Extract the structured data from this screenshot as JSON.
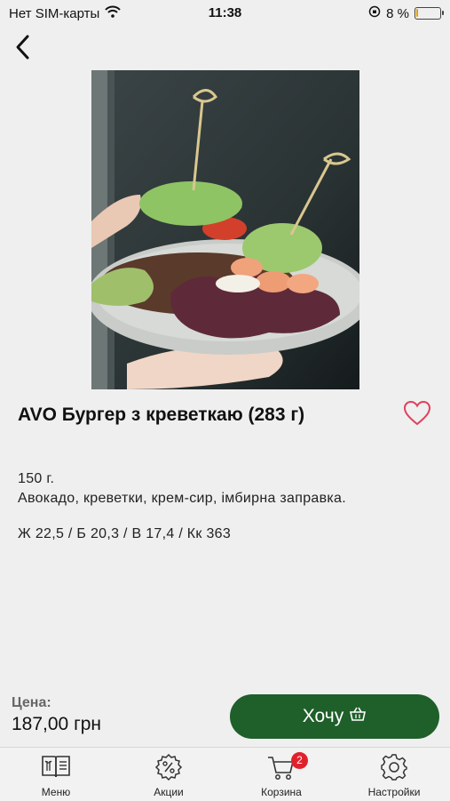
{
  "status_bar": {
    "carrier": "Нет SIM-карты",
    "time": "11:38",
    "battery_percent_label": "8 %",
    "battery_level": 0.08
  },
  "product": {
    "title": "AVO Бургер з креветкаю (283 г)",
    "weight": "150 г.",
    "ingredients": "Авокадо, креветки, крем-сир,  імбирна заправка.",
    "nutrition": "Ж 22,5 / Б 20,3 / В 17,4 / Кк 363"
  },
  "price": {
    "label": "Цена:",
    "value": "187,00 грн"
  },
  "order_button": {
    "label": "Хочу"
  },
  "tab_bar": {
    "items": [
      {
        "label": "Меню"
      },
      {
        "label": "Акции"
      },
      {
        "label": "Корзина",
        "badge": "2"
      },
      {
        "label": "Настройки"
      }
    ]
  },
  "colors": {
    "accent": "#1f5f2a",
    "favorite": "#e0405e",
    "badge": "#e0212c"
  }
}
